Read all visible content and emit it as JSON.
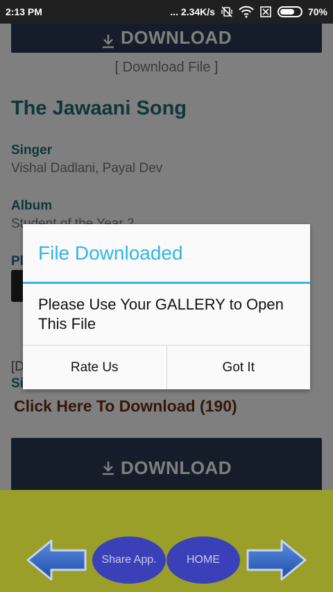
{
  "status_bar": {
    "time": "2:13 PM",
    "network_speed": "... 2.34K/s",
    "battery": "70%",
    "battery_level": 0.7
  },
  "page": {
    "top_download_label": "DOWNLOAD",
    "download_file_link": "[ Download File ]",
    "song_title": "The Jawaani Song",
    "singer_label": "Singer",
    "singer_value": "Vishal Dadlani, Payal Dev",
    "album_label": "Album",
    "album_value": "Student of the Year 2",
    "partial_label_1": "Pl",
    "partial_label_2": "[D",
    "partial_label_3": "Si",
    "click_download": "Click Here To Download (190)",
    "bottom_download_label": "DOWNLOAD"
  },
  "dialog": {
    "title": "File Downloaded",
    "message": "Please Use Your GALLERY to Open This File",
    "rate_button": "Rate Us",
    "got_it_button": "Got It"
  },
  "bottom_bar": {
    "share_label": "Share App.",
    "home_label": "HOME"
  },
  "colors": {
    "accent": "#33b5e5",
    "title_teal": "#1f6e74",
    "download_button_bg": "#2b3a55",
    "bottom_bar_bg": "#9a9f2a",
    "oval_bg": "#3a41b8"
  }
}
